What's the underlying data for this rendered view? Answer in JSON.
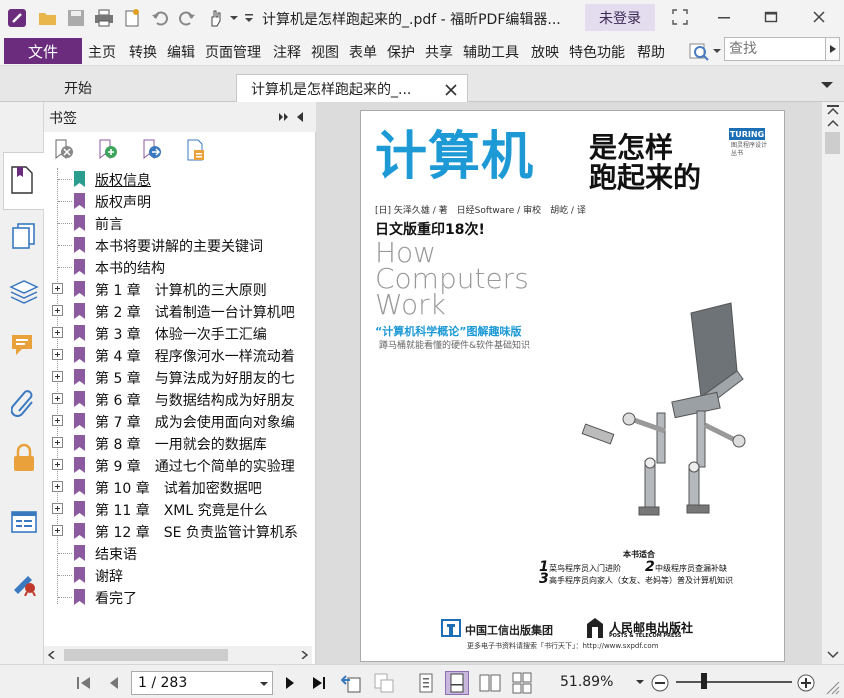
{
  "window": {
    "title": "计算机是怎样跑起来的_.pdf - 福昕PDF编辑器...",
    "login_label": "未登录"
  },
  "menu": {
    "file": "文件",
    "items": [
      "主页",
      "转换",
      "编辑",
      "页面管理",
      "注释",
      "视图",
      "表单",
      "保护",
      "共享",
      "辅助工具",
      "放映",
      "特色功能",
      "帮助"
    ],
    "search_placeholder": "查找"
  },
  "tabs": {
    "start": "开始",
    "document": "计算机是怎样跑起来的_..."
  },
  "bookmarks": {
    "title": "书签",
    "items": [
      {
        "label": "版权信息",
        "expandable": false,
        "selected": true
      },
      {
        "label": "版权声明",
        "expandable": false
      },
      {
        "label": "前言",
        "expandable": false
      },
      {
        "label": "本书将要讲解的主要关键词",
        "expandable": false
      },
      {
        "label": "本书的结构",
        "expandable": false
      },
      {
        "label": "第 1 章　计算机的三大原则",
        "expandable": true
      },
      {
        "label": "第 2 章　试着制造一台计算机吧",
        "expandable": true
      },
      {
        "label": "第 3 章　体验一次手工汇编",
        "expandable": true
      },
      {
        "label": "第 4 章　程序像河水一样流动着",
        "expandable": true
      },
      {
        "label": "第 5 章　与算法成为好朋友的七",
        "expandable": true
      },
      {
        "label": "第 6 章　与数据结构成为好朋友",
        "expandable": true
      },
      {
        "label": "第 7 章　成为会使用面向对象编",
        "expandable": true
      },
      {
        "label": "第 8 章　一用就会的数据库",
        "expandable": true
      },
      {
        "label": "第 9 章　通过七个简单的实验理",
        "expandable": true
      },
      {
        "label": "第 10 章　试着加密数据吧",
        "expandable": true
      },
      {
        "label": "第 11 章　XML 究竟是什么",
        "expandable": true
      },
      {
        "label": "第 12 章　SE 负责监管计算机系",
        "expandable": true
      },
      {
        "label": "结束语",
        "expandable": false
      },
      {
        "label": "谢辞",
        "expandable": false
      },
      {
        "label": "看完了",
        "expandable": false
      }
    ]
  },
  "cover": {
    "badge": "TURING",
    "series": "图灵程序设计丛书",
    "title_big": "计算机",
    "title_small1": "是怎样",
    "title_small2": "跑起来的",
    "authors": "[日] 矢泽久雄 / 著　日经Software / 审校　胡屹 / 译",
    "reprint": "日文版重印18次!",
    "en1": "How",
    "en2": "Computers",
    "en3": "Work",
    "tagline": "“计算机科学概论”图解趣味版",
    "subtagline": "蹲马桶就能看懂的硬件&软件基础知识",
    "suit_title": "本书适合",
    "suit1": "菜鸟程序员入门进阶",
    "suit2": "中级程序员查漏补缺",
    "suit3": "高手程序员向家人（女友、老妈等）普及计算机知识",
    "pub1": "中国工信出版集团",
    "pub2": "人民邮电出版社",
    "pub2_en": "POSTS & TELECOM PRESS",
    "footer": "更多电子书资料请搜索「书行天下」：http://www.sxpdf.com"
  },
  "status": {
    "page": "1 / 283",
    "zoom": "51.89%"
  },
  "colors": {
    "brand": "#6b2c7e",
    "cover_blue": "#1d9ad6",
    "bookmark_flag": "#8c5a9e"
  }
}
